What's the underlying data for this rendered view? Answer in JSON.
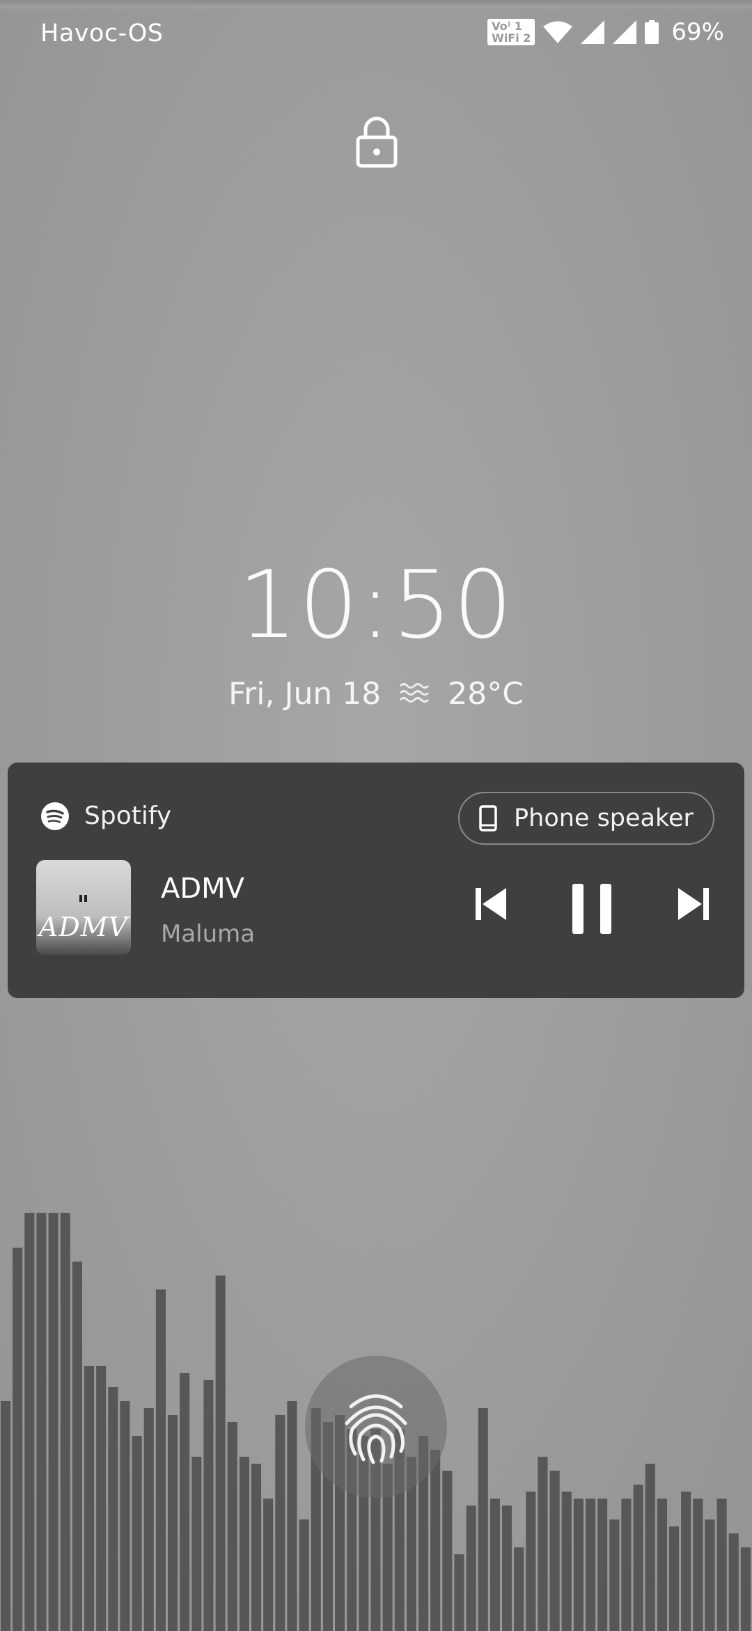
{
  "status_bar": {
    "carrier": "Havoc-OS",
    "vowifi_top": "Vo⁾ 1",
    "vowifi_bottom": "WiFi 2",
    "battery_percent": "69%",
    "icons": [
      "vowifi-icon",
      "wifi-icon",
      "signal-icon",
      "signal-icon",
      "battery-icon"
    ]
  },
  "lockscreen": {
    "time": "10:50",
    "date": "Fri, Jun 18",
    "weather_icon": "haze-icon",
    "temperature": "28°C"
  },
  "media": {
    "app_name": "Spotify",
    "app_icon": "spotify-icon",
    "output_device": "Phone speaker",
    "output_icon": "phone-icon",
    "album_art_text": "ADMV",
    "track_title": "ADMV",
    "artist": "Maluma",
    "controls": [
      "previous-icon",
      "pause-icon",
      "next-icon"
    ],
    "card_color": "#3f3f3f"
  },
  "visualizer": {
    "bar_color": "#575757",
    "levels": [
      0.33,
      0.55,
      0.6,
      0.6,
      0.62,
      0.6,
      0.53,
      0.38,
      0.38,
      0.35,
      0.33,
      0.28,
      0.32,
      0.49,
      0.31,
      0.37,
      0.25,
      0.36,
      0.51,
      0.3,
      0.25,
      0.24,
      0.19,
      0.31,
      0.33,
      0.16,
      0.32,
      0.3,
      0.31,
      0.29,
      0.28,
      0.29,
      0.24,
      0.29,
      0.25,
      0.28,
      0.26,
      0.23,
      0.11,
      0.18,
      0.32,
      0.19,
      0.18,
      0.12,
      0.2,
      0.25,
      0.23,
      0.2,
      0.19,
      0.19,
      0.19,
      0.16,
      0.19,
      0.21,
      0.24,
      0.19,
      0.15,
      0.2,
      0.19,
      0.16,
      0.19,
      0.14,
      0.12
    ]
  }
}
